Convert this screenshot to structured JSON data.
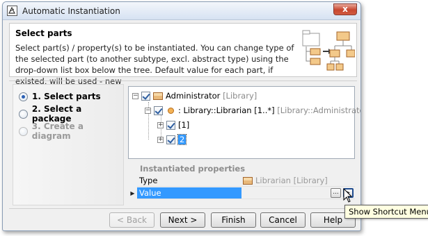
{
  "window": {
    "title": "Automatic Instantiation",
    "close_glyph": "x"
  },
  "header": {
    "title": "Select parts",
    "description": "Select part(s) / property(s) to be instantiated. You can change type of the selected part (to another subtype, excl. abstract type) using the drop-down list box below the tree. Default value for each part, if existed, will be used - new"
  },
  "steps": [
    {
      "label": "1. Select parts",
      "checked": true,
      "enabled": true
    },
    {
      "label": "2. Select a package",
      "checked": false,
      "enabled": true
    },
    {
      "label": "3. Create a diagram",
      "checked": false,
      "enabled": false
    }
  ],
  "tree": {
    "root": {
      "name": "Administrator",
      "type": "[Library]",
      "checked": true
    },
    "child": {
      "name": ": Library::Librarian [1..*]",
      "type": "[Library::Administrator]",
      "checked": true
    },
    "slots": [
      {
        "label": "[1]",
        "checked": true
      },
      {
        "label": "2",
        "checked": true,
        "selected": true
      }
    ]
  },
  "properties": {
    "title": "Instantiated properties",
    "rows": [
      {
        "key": "Type",
        "value": "Librarian [Library]"
      },
      {
        "key": "Value",
        "value": "",
        "selected": true,
        "ellipsis": "...",
        "arrow": "▸"
      }
    ]
  },
  "buttons": {
    "back": "< Back",
    "next": "Next >",
    "finish": "Finish",
    "cancel": "Cancel",
    "help": "Help"
  },
  "tooltip": "Show Shortcut Menu",
  "colors": {
    "selection": "#3399ff",
    "tooltip_bg": "#ffffe1",
    "close": "#c8472f"
  }
}
